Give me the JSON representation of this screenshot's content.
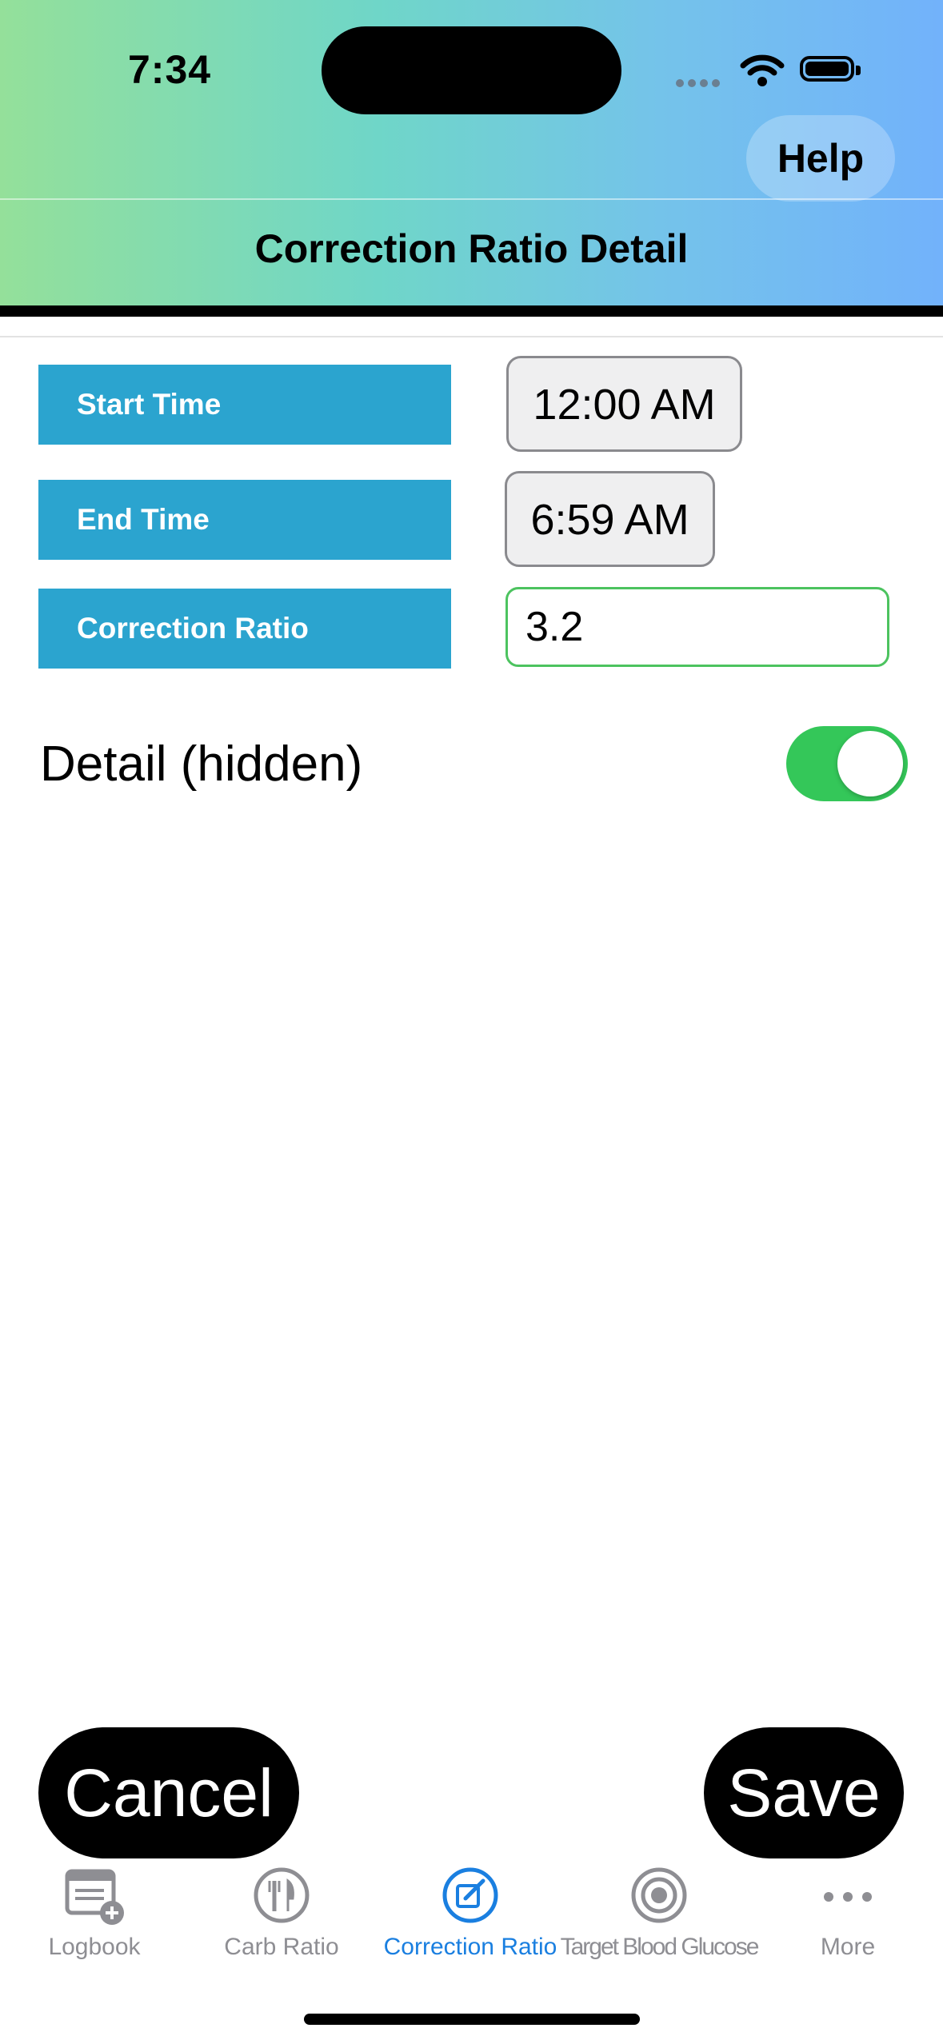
{
  "status_bar": {
    "time": "7:34"
  },
  "header": {
    "help_label": "Help",
    "title": "Correction Ratio Detail"
  },
  "form": {
    "start_time_label": "Start Time",
    "start_time_value": "12:00 AM",
    "end_time_label": "End Time",
    "end_time_value": "6:59 AM",
    "correction_ratio_label": "Correction Ratio",
    "correction_ratio_value": "3.2"
  },
  "detail": {
    "label": "Detail (hidden)",
    "toggle_on": true
  },
  "actions": {
    "cancel_label": "Cancel",
    "save_label": "Save"
  },
  "tabbar": {
    "items": [
      {
        "label": "Logbook",
        "icon": "logbook-icon",
        "active": false
      },
      {
        "label": "Carb Ratio",
        "icon": "fork-knife-icon",
        "active": false
      },
      {
        "label": "Correction Ratio",
        "icon": "edit-icon",
        "active": true
      },
      {
        "label": "Target Blood Glucose",
        "icon": "target-icon",
        "active": false
      },
      {
        "label": "More",
        "icon": "more-icon",
        "active": false
      }
    ]
  },
  "colors": {
    "label_bg": "#2ba4cf",
    "tab_active": "#1a7fe0",
    "tab_inactive": "#8e8e93",
    "toggle_on": "#34c759",
    "input_border": "#4cc35f"
  }
}
